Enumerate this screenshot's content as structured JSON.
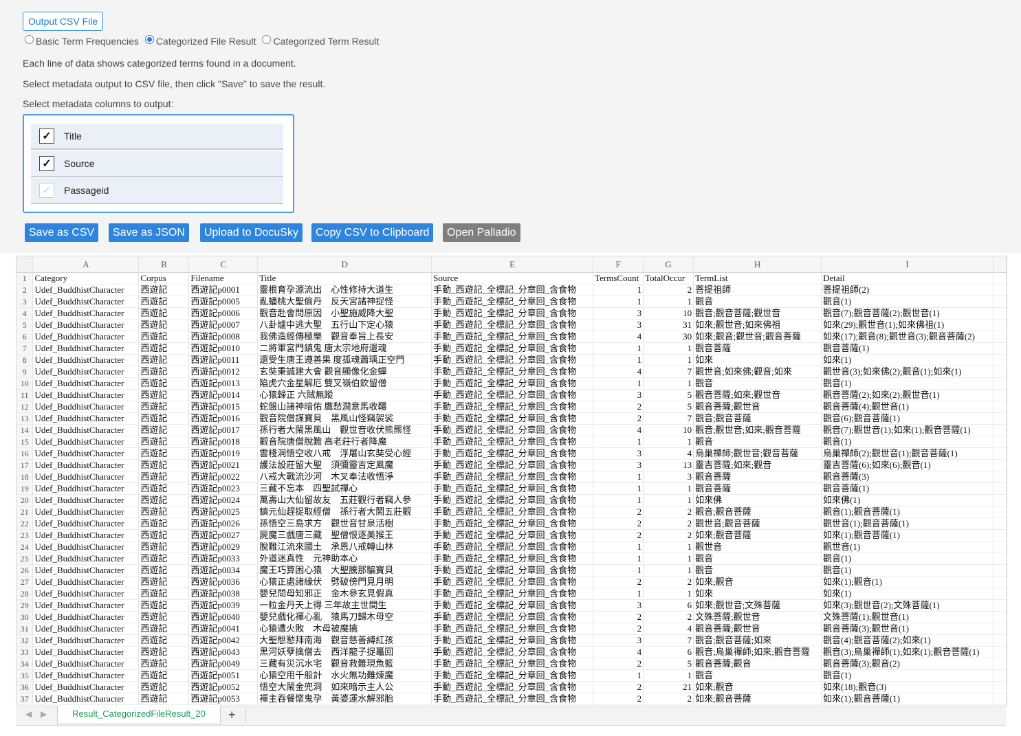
{
  "output_button": "Output CSV File",
  "radios": [
    {
      "label": "Basic Term Frequencies",
      "checked": false
    },
    {
      "label": "Categorized File Result",
      "checked": true
    },
    {
      "label": "Categorized Term Result",
      "checked": false
    }
  ],
  "desc1": "Each line of data shows categorized terms found in a document.",
  "desc2": "Select metadata output to CSV file, then click \"Save\" to save the result.",
  "desc3": "Select metadata columns to output:",
  "meta": [
    {
      "label": "Title",
      "checked": true
    },
    {
      "label": "Source",
      "checked": true
    },
    {
      "label": "Passageid",
      "checked": false
    }
  ],
  "actions": [
    "Save as CSV",
    "Save as JSON",
    "Upload to DocuSky",
    "Copy CSV to Clipboard",
    "Open Palladio"
  ],
  "sheet": {
    "columns": [
      "A",
      "B",
      "C",
      "D",
      "E",
      "F",
      "G",
      "H",
      "I"
    ],
    "header": [
      "Category",
      "Corpus",
      "Filename",
      "Title",
      "Source",
      "TermsCount",
      "TotalOccur",
      "TermList",
      "Detail"
    ],
    "rows": [
      [
        "Udef_BuddhistCharacter",
        "西遊記",
        "西遊記p0001",
        "靈根育孕源流出　心性修持大道生",
        "手動_西遊記_全標記_分章回_含食物",
        "1",
        "2",
        "菩提祖師",
        "菩提祖師(2)"
      ],
      [
        "Udef_BuddhistCharacter",
        "西遊記",
        "西遊記p0005",
        "亂蟠桃大聖偷丹　反天宮諸神捉怪",
        "手動_西遊記_全標記_分章回_含食物",
        "1",
        "1",
        "觀音",
        "觀音(1)"
      ],
      [
        "Udef_BuddhistCharacter",
        "西遊記",
        "西遊記p0006",
        "觀音赴會問原因　小聖施威降大聖",
        "手動_西遊記_全標記_分章回_含食物",
        "3",
        "10",
        "觀音;觀音菩薩;觀世音",
        "觀音(7);觀音菩薩(2);觀世音(1)"
      ],
      [
        "Udef_BuddhistCharacter",
        "西遊記",
        "西遊記p0007",
        "八卦爐中逃大聖　五行山下定心猿",
        "手動_西遊記_全標記_分章回_含食物",
        "3",
        "31",
        "如來;觀世音;如來佛祖",
        "如來(29);觀世音(1);如來佛祖(1)"
      ],
      [
        "Udef_BuddhistCharacter",
        "西遊記",
        "西遊記p0008",
        "我佛造經傳極樂　觀音奉旨上長安",
        "手動_西遊記_全標記_分章回_含食物",
        "4",
        "30",
        "如來;觀音;觀世音;觀音菩薩",
        "如來(17);觀音(8);觀世音(3);觀音菩薩(2)"
      ],
      [
        "Udef_BuddhistCharacter",
        "西遊記",
        "西遊記p0010",
        "二將軍宮門鎮鬼 唐太宗地府還魂",
        "手動_西遊記_全標記_分章回_含食物",
        "1",
        "1",
        "觀音菩薩",
        "觀音菩薩(1)"
      ],
      [
        "Udef_BuddhistCharacter",
        "西遊記",
        "西遊記p0011",
        "還受生唐王遵善果 度孤魂蕭瑀正空門",
        "手動_西遊記_全標記_分章回_含食物",
        "1",
        "1",
        "如來",
        "如來(1)"
      ],
      [
        "Udef_BuddhistCharacter",
        "西遊記",
        "西遊記p0012",
        "玄奘秉誠建大會 觀音顯像化金蟬",
        "手動_西遊記_全標記_分章回_含食物",
        "4",
        "7",
        "觀世音;如來佛;觀音;如來",
        "觀世音(3);如來佛(2);觀音(1);如來(1)"
      ],
      [
        "Udef_BuddhistCharacter",
        "西遊記",
        "西遊記p0013",
        "陷虎穴金星解厄 雙叉嶺伯欽留僧",
        "手動_西遊記_全標記_分章回_含食物",
        "1",
        "1",
        "觀音",
        "觀音(1)"
      ],
      [
        "Udef_BuddhistCharacter",
        "西遊記",
        "西遊記p0014",
        "心猿歸正 六賊無蹤",
        "手動_西遊記_全標記_分章回_含食物",
        "3",
        "5",
        "觀音菩薩;如來;觀世音",
        "觀音菩薩(2);如來(2);觀世音(1)"
      ],
      [
        "Udef_BuddhistCharacter",
        "西遊記",
        "西遊記p0015",
        "蛇盤山諸神暗佑 鷹愁澗意馬收韁",
        "手動_西遊記_全標記_分章回_含食物",
        "2",
        "5",
        "觀音菩薩;觀世音",
        "觀音菩薩(4);觀世音(1)"
      ],
      [
        "Udef_BuddhistCharacter",
        "西遊記",
        "西遊記p0016",
        "觀音院僧謀寶貝　黑風山怪竊袈裟",
        "手動_西遊記_全標記_分章回_含食物",
        "2",
        "7",
        "觀音;觀音菩薩",
        "觀音(6);觀音菩薩(1)"
      ],
      [
        "Udef_BuddhistCharacter",
        "西遊記",
        "西遊記p0017",
        "孫行者大鬧黑風山　觀世音收伏熊羆怪",
        "手動_西遊記_全標記_分章回_含食物",
        "4",
        "10",
        "觀音;觀世音;如來;觀音菩薩",
        "觀音(7);觀世音(1);如來(1);觀音菩薩(1)"
      ],
      [
        "Udef_BuddhistCharacter",
        "西遊記",
        "西遊記p0018",
        "觀音院唐僧脫難 高老莊行者降魔",
        "手動_西遊記_全標記_分章回_含食物",
        "1",
        "1",
        "觀音",
        "觀音(1)"
      ],
      [
        "Udef_BuddhistCharacter",
        "西遊記",
        "西遊記p0019",
        "雲棧洞悟空收八戒　浮屠山玄奘受心經",
        "手動_西遊記_全標記_分章回_含食物",
        "3",
        "4",
        "烏巢禪師;觀世音;觀音菩薩",
        "烏巢禪師(2);觀世音(1);觀音菩薩(1)"
      ],
      [
        "Udef_BuddhistCharacter",
        "西遊記",
        "西遊記p0021",
        "護法設莊留大聖　須彌靈吉定風魔",
        "手動_西遊記_全標記_分章回_含食物",
        "3",
        "13",
        "靈吉菩薩;如來;觀音",
        "靈吉菩薩(6);如來(6);觀音(1)"
      ],
      [
        "Udef_BuddhistCharacter",
        "西遊記",
        "西遊記p0022",
        "八戒大戰流沙河　木叉奉法收悟淨",
        "手動_西遊記_全標記_分章回_含食物",
        "1",
        "3",
        "觀音菩薩",
        "觀音菩薩(3)"
      ],
      [
        "Udef_BuddhistCharacter",
        "西遊記",
        "西遊記p0023",
        "三藏不忘本　四聖試禪心",
        "手動_西遊記_全標記_分章回_含食物",
        "1",
        "1",
        "觀音菩薩",
        "觀音菩薩(1)"
      ],
      [
        "Udef_BuddhistCharacter",
        "西遊記",
        "西遊記p0024",
        "萬壽山大仙留故友　五莊觀行者竊人參",
        "手動_西遊記_全標記_分章回_含食物",
        "1",
        "1",
        "如來佛",
        "如來佛(1)"
      ],
      [
        "Udef_BuddhistCharacter",
        "西遊記",
        "西遊記p0025",
        "鎮元仙趕捉取經僧　孫行者大鬧五莊觀",
        "手動_西遊記_全標記_分章回_含食物",
        "2",
        "2",
        "觀音;觀音菩薩",
        "觀音(1);觀音菩薩(1)"
      ],
      [
        "Udef_BuddhistCharacter",
        "西遊記",
        "西遊記p0026",
        "孫悟空三島求方　觀世音甘泉活樹",
        "手動_西遊記_全標記_分章回_含食物",
        "2",
        "2",
        "觀世音;觀音菩薩",
        "觀世音(1);觀音菩薩(1)"
      ],
      [
        "Udef_BuddhistCharacter",
        "西遊記",
        "西遊記p0027",
        "屍魔三戲唐三藏　聖僧恨逐美猴王",
        "手動_西遊記_全標記_分章回_含食物",
        "2",
        "2",
        "如來;觀音菩薩",
        "如來(1);觀音菩薩(1)"
      ],
      [
        "Udef_BuddhistCharacter",
        "西遊記",
        "西遊記p0029",
        "脫難江流來國土　承恩八戒轉山林",
        "手動_西遊記_全標記_分章回_含食物",
        "1",
        "1",
        "觀世音",
        "觀世音(1)"
      ],
      [
        "Udef_BuddhistCharacter",
        "西遊記",
        "西遊記p0033",
        "外道迷真性　元神助本心",
        "手動_西遊記_全標記_分章回_含食物",
        "1",
        "1",
        "觀音",
        "觀音(1)"
      ],
      [
        "Udef_BuddhistCharacter",
        "西遊記",
        "西遊記p0034",
        "魔王巧算困心猿　大聖騰那騙寶貝",
        "手動_西遊記_全標記_分章回_含食物",
        "1",
        "1",
        "觀音",
        "觀音(1)"
      ],
      [
        "Udef_BuddhistCharacter",
        "西遊記",
        "西遊記p0036",
        "心猿正處諸緣伏　劈破傍門見月明",
        "手動_西遊記_全標記_分章回_含食物",
        "2",
        "2",
        "如來;觀音",
        "如來(1);觀音(1)"
      ],
      [
        "Udef_BuddhistCharacter",
        "西遊記",
        "西遊記p0038",
        "嬰兒問母知邪正　金木參玄見假真",
        "手動_西遊記_全標記_分章回_含食物",
        "1",
        "1",
        "如來",
        "如來(1)"
      ],
      [
        "Udef_BuddhistCharacter",
        "西遊記",
        "西遊記p0039",
        "一粒金丹天上得 三年故主世間生",
        "手動_西遊記_全標記_分章回_含食物",
        "3",
        "6",
        "如來;觀世音;文殊菩薩",
        "如來(3);觀世音(2);文殊菩薩(1)"
      ],
      [
        "Udef_BuddhistCharacter",
        "西遊記",
        "西遊記p0040",
        "嬰兒戲化禪心亂　猿馬刀歸木母空",
        "手動_西遊記_全標記_分章回_含食物",
        "2",
        "2",
        "文殊菩薩;觀世音",
        "文殊菩薩(1);觀世音(1)"
      ],
      [
        "Udef_BuddhistCharacter",
        "西遊記",
        "西遊記p0041",
        "心猿遭火敗　木母被魔擒",
        "手動_西遊記_全標記_分章回_含食物",
        "2",
        "4",
        "觀音菩薩;觀世音",
        "觀音菩薩(3);觀世音(1)"
      ],
      [
        "Udef_BuddhistCharacter",
        "西遊記",
        "西遊記p0042",
        "大聖慇懃拜南海　觀音慈善縛紅孩",
        "手動_西遊記_全標記_分章回_含食物",
        "3",
        "7",
        "觀音;觀音菩薩;如來",
        "觀音(4);觀音菩薩(2);如來(1)"
      ],
      [
        "Udef_BuddhistCharacter",
        "西遊記",
        "西遊記p0043",
        "黑河妖孽擒僧去　西洋龍子捉鼉回",
        "手動_西遊記_全標記_分章回_含食物",
        "4",
        "6",
        "觀音;烏巢禪師;如來;觀音菩薩",
        "觀音(3);烏巢禪師(1);如來(1);觀音菩薩(1)"
      ],
      [
        "Udef_BuddhistCharacter",
        "西遊記",
        "西遊記p0049",
        "三藏有災沉水宅　觀音救難現魚籃",
        "手動_西遊記_全標記_分章回_含食物",
        "2",
        "5",
        "觀音菩薩;觀音",
        "觀音菩薩(3);觀音(2)"
      ],
      [
        "Udef_BuddhistCharacter",
        "西遊記",
        "西遊記p0051",
        "心猿空用千般計　水火無功難煉魔",
        "手動_西遊記_全標記_分章回_含食物",
        "1",
        "1",
        "觀音",
        "觀音(1)"
      ],
      [
        "Udef_BuddhistCharacter",
        "西遊記",
        "西遊記p0052",
        "悟空大鬧金兜洞　如來暗示主人公",
        "手動_西遊記_全標記_分章回_含食物",
        "2",
        "21",
        "如來;觀音",
        "如來(18);觀音(3)"
      ],
      [
        "Udef_BuddhistCharacter",
        "西遊記",
        "西遊記p0053",
        "禪主吞餐懷鬼孕　黃婆運水解邪胎",
        "手動_西遊記_全標記_分章回_含食物",
        "2",
        "2",
        "如來;觀音菩薩",
        "如來(1);觀音菩薩(1)"
      ]
    ],
    "tab_name": "Result_CategorizedFileResult_20",
    "add_tab": "+",
    "prev_arrow": "◀",
    "next_arrow": "▶"
  }
}
